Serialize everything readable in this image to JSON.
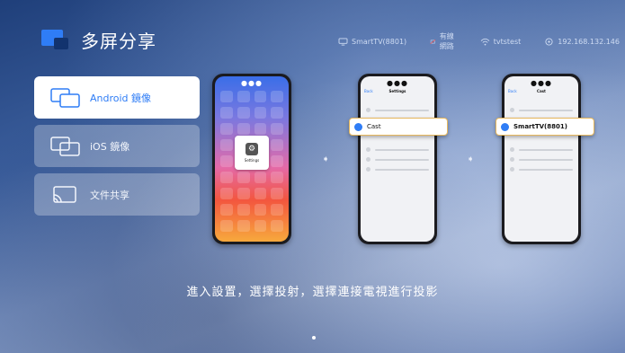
{
  "app": {
    "title": "多屏分享"
  },
  "status": {
    "device_name": "SmartTV(8801)",
    "wired": "有線網路",
    "wifi": "tvtstest",
    "ip": "192.168.132.146"
  },
  "menu": [
    {
      "label": "Android 鏡像",
      "icon": "screen-mirror-icon",
      "selected": true
    },
    {
      "label": "iOS 鏡像",
      "icon": "screen-mirror-icon",
      "selected": false
    },
    {
      "label": "文件共享",
      "icon": "cast-icon",
      "selected": false
    }
  ],
  "steps": {
    "settings_app_label": "Settings",
    "back_label": "Back",
    "settings_title": "Settings",
    "cast_option": "Cast",
    "cast_title": "Cast",
    "tv_option": "SmartTV(8801)"
  },
  "instruction": "進入設置，選擇投射，選擇連接電視進行投影",
  "colors": {
    "accent": "#2f7df6"
  }
}
